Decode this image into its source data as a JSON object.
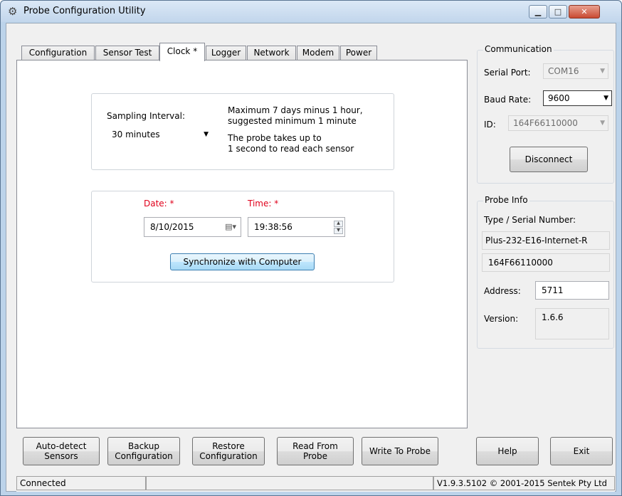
{
  "window": {
    "title": "Probe Configuration Utility",
    "min_glyph": "▁",
    "max_glyph": "□",
    "close_glyph": "✕",
    "icon": "probe-app-icon"
  },
  "tabs": [
    {
      "label": "Configuration",
      "active": false
    },
    {
      "label": "Sensor Test",
      "active": false
    },
    {
      "label": "Clock *",
      "active": true
    },
    {
      "label": "Logger",
      "active": false
    },
    {
      "label": "Network",
      "active": false
    },
    {
      "label": "Modem",
      "active": false
    },
    {
      "label": "Power",
      "active": false
    }
  ],
  "clock": {
    "sampling_label": "Sampling Interval:",
    "sampling_value": "30 minutes",
    "info_line1": "Maximum 7 days minus 1 hour,",
    "info_line2": "suggested minimum 1 minute",
    "info_line3": "The probe takes up to",
    "info_line4": "1 second to read each sensor",
    "date_label": "Date: *",
    "time_label": "Time: *",
    "date_value": "8/10/2015",
    "time_value": "19:38:56",
    "sync_button": "Synchronize with Computer"
  },
  "communication": {
    "group_title": "Communication",
    "serial_port_label": "Serial Port:",
    "serial_port_value": "COM16",
    "baud_rate_label": "Baud Rate:",
    "baud_rate_value": "9600",
    "id_label": "ID:",
    "id_value": "164F66110000",
    "disconnect_button": "Disconnect"
  },
  "probe_info": {
    "group_title": "Probe Info",
    "type_serial_label": "Type / Serial Number:",
    "type_value": "Plus-232-E16-Internet-R",
    "serial_value": "164F66110000",
    "address_label": "Address:",
    "address_value": "5711",
    "version_label": "Version:",
    "version_value": "1.6.6"
  },
  "bottom_buttons": {
    "auto_detect_l1": "Auto-detect",
    "auto_detect_l2": "Sensors",
    "backup_l1": "Backup",
    "backup_l2": "Configuration",
    "restore_l1": "Restore",
    "restore_l2": "Configuration",
    "read_l1": "Read From",
    "read_l2": "Probe",
    "write": "Write To Probe",
    "help": "Help",
    "exit": "Exit"
  },
  "status": {
    "connection": "Connected",
    "middle": "",
    "version": "V1.9.3.5102 © 2001-2015 Sentek Pty Ltd"
  }
}
